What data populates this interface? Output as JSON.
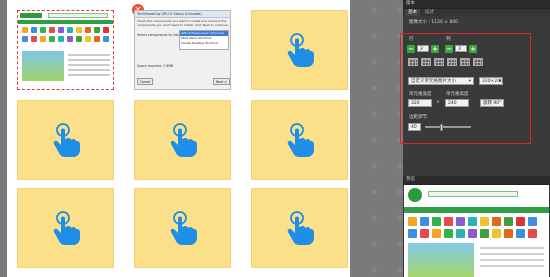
{
  "panel": {
    "layout_title": "版本",
    "tabs": [
      "基本",
      "描述"
    ],
    "image_size_label": "图像大小 : 1120 × 800",
    "rows_label": "行",
    "cols_label": "列",
    "rows_value": "3",
    "cols_value": "3",
    "scale_select": "自定义单元格图片大小",
    "size_select": "320×240",
    "cell_width_label": "单元格宽度",
    "cell_height_label": "单元格高度",
    "cell_width_value": "320",
    "times_sign": "×",
    "cell_height_value": "240",
    "rotate_label": "旋转 90°",
    "border_label": "边距调节",
    "border_value": "40",
    "minus_glyph": "−",
    "plus_glyph": "+",
    "preview_title": "预览",
    "accent_color": "#38a83a",
    "highlight_color": "#d9232e"
  },
  "cells": [
    {
      "kind": "website-screenshot"
    },
    {
      "kind": "installer-screenshot"
    },
    {
      "kind": "placeholder",
      "icon": "tap-hand-icon"
    },
    {
      "kind": "placeholder",
      "icon": "tap-hand-icon"
    },
    {
      "kind": "placeholder",
      "icon": "tap-hand-icon"
    },
    {
      "kind": "placeholder",
      "icon": "tap-hand-icon"
    },
    {
      "kind": "placeholder",
      "icon": "tap-hand-icon"
    },
    {
      "kind": "placeholder",
      "icon": "tap-hand-icon"
    },
    {
      "kind": "placeholder",
      "icon": "tap-hand-icon"
    }
  ],
  "installer": {
    "title": "TechPowerUp GPU-Z Setup (Unicode)",
    "header_text": "Check the components you want to install and uncheck the components you don't want to install. Click Next to continue.",
    "select_label": "Select components to install:",
    "options": [
      "GPU-Z Powerusers (Unicode)",
      "Start Menu Shortcut",
      "Create Desktop Shortcut"
    ],
    "space_required": "Space required: 2.6MB",
    "cancel_label": "Cancel",
    "next_label": "Next >"
  },
  "colors": {
    "cell_bg": "#fbe089",
    "hand": "#1e8ee6",
    "badge": "#e8532c"
  }
}
